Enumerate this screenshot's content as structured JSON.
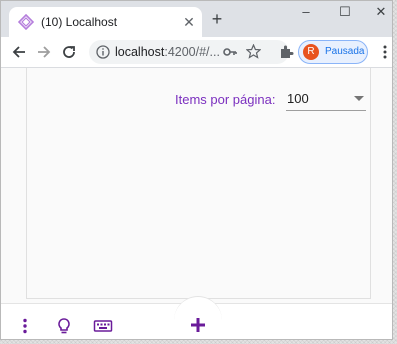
{
  "browser": {
    "tab_title": "(10) Localhost",
    "new_tab_label": "+",
    "url_host": "localhost",
    "url_rest": ":4200/#/...",
    "profile_initial": "R",
    "profile_label": "Pausada"
  },
  "page": {
    "items_per_page_label": "Items por página:",
    "items_per_page_value": "100"
  },
  "colors": {
    "accent": "#7b2fbf",
    "icon_purple": "#6a1b9a",
    "profile_avatar": "#e8531f"
  }
}
